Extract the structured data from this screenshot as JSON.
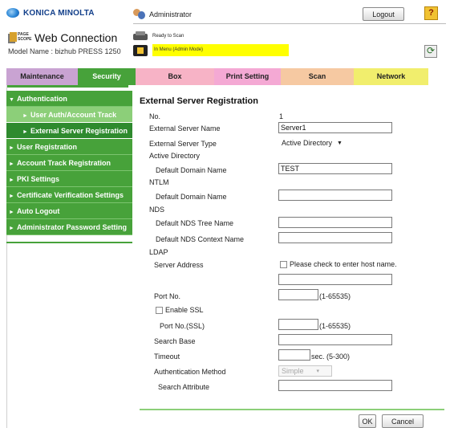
{
  "header": {
    "brand": "KONICA MINOLTA",
    "pagescope_icon_text": "PAGE SCOPE",
    "app_title": "Web Connection",
    "model_label": "Model Name : bizhub PRESS 1250",
    "user": "Administrator",
    "logout_label": "Logout",
    "help_label": "?",
    "status_ready": "Ready to Scan",
    "status_mode": "In Menu (Admin Mode)",
    "refresh_icon": "refresh-icon"
  },
  "tabs": [
    {
      "label": "Maintenance",
      "color": "#c9a3d2"
    },
    {
      "label": "Security",
      "color": "#47a23a",
      "active": true
    },
    {
      "label": "Box",
      "color": "#f7b3c6"
    },
    {
      "label": "Print Setting",
      "color": "#f4a9d4"
    },
    {
      "label": "Scan",
      "color": "#f6c9a2"
    },
    {
      "label": "Network",
      "color": "#f1ee6d"
    }
  ],
  "sidebar": {
    "items": [
      {
        "label": "Authentication",
        "arrow": "▼"
      },
      {
        "label": "User Auth/Account Track",
        "arrow": "►",
        "sub": true
      },
      {
        "label": "External Server Registration",
        "arrow": "►",
        "sub": true,
        "current": true
      },
      {
        "label": "User Registration",
        "arrow": "►"
      },
      {
        "label": "Account Track Registration",
        "arrow": "►"
      },
      {
        "label": "PKI Settings",
        "arrow": "►"
      },
      {
        "label": "Certificate Verification Settings",
        "arrow": "►"
      },
      {
        "label": "Auto Logout",
        "arrow": "►"
      },
      {
        "label": "Administrator Password Setting",
        "arrow": "►"
      }
    ]
  },
  "main": {
    "title": "External Server Registration",
    "no_label": "No.",
    "no_value": "1",
    "server_name_label": "External Server Name",
    "server_name_value": "Server1",
    "server_type_label": "External Server Type",
    "server_type_value": "Active Directory",
    "ad_heading": "Active Directory",
    "ad_domain_label": "Default Domain Name",
    "ad_domain_value": "TEST",
    "ntlm_heading": "NTLM",
    "ntlm_domain_label": "Default Domain Name",
    "ntlm_domain_value": "",
    "nds_heading": "NDS",
    "nds_tree_label": "Default NDS Tree Name",
    "nds_tree_value": "",
    "nds_context_label": "Default NDS Context Name",
    "nds_context_value": "",
    "ldap_heading": "LDAP",
    "server_address_label": "Server Address",
    "host_check_label": "Please check to enter host name.",
    "server_address_value": "",
    "port_label": "Port No.",
    "port_value": "",
    "port_range": "(1-65535)",
    "ssl_label": "Enable SSL",
    "port_ssl_label": "Port No.(SSL)",
    "port_ssl_value": "",
    "port_ssl_range": "(1-65535)",
    "search_base_label": "Search Base",
    "search_base_value": "",
    "timeout_label": "Timeout",
    "timeout_value": "",
    "timeout_range": "sec. (5-300)",
    "auth_method_label": "Authentication Method",
    "auth_method_value": "Simple",
    "search_attr_label": "Search Attribute",
    "search_attr_value": "",
    "ok_label": "OK",
    "cancel_label": "Cancel"
  }
}
